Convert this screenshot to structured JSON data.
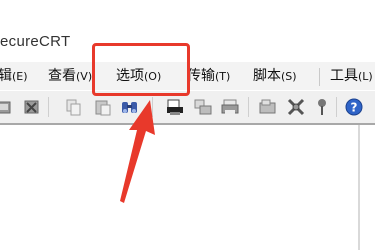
{
  "window": {
    "title": "ecureCRT"
  },
  "menubar": {
    "items": [
      {
        "label": "辑",
        "accel": "(E)"
      },
      {
        "label": "查看",
        "accel": "(V)"
      },
      {
        "label": "选项",
        "accel": "(O)"
      },
      {
        "label": "传输",
        "accel": "(T)"
      },
      {
        "label": "脚本",
        "accel": "(S)"
      },
      {
        "label": "工具",
        "accel": "(L)"
      }
    ]
  },
  "toolbar": {
    "icons": [
      "reconnect-icon",
      "disconnect-icon",
      "copy-icon",
      "paste-icon",
      "find-icon",
      "print-setup-icon",
      "print-screen-icon",
      "print-icon",
      "session-options-icon",
      "global-options-icon",
      "keymap-icon",
      "help-icon"
    ]
  },
  "annotation": {
    "highlight_color": "#e8392b"
  }
}
